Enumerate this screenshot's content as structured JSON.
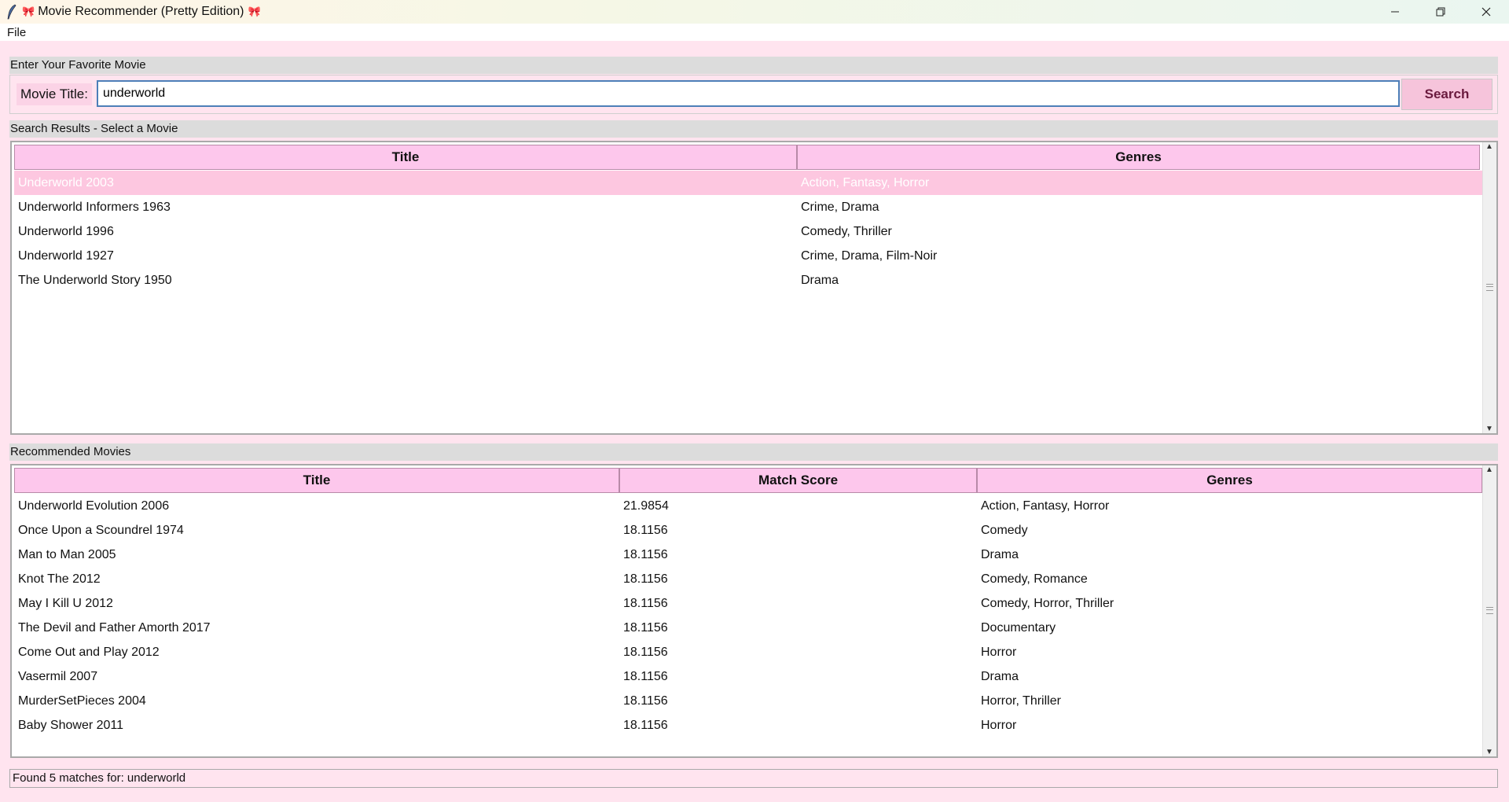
{
  "window": {
    "title": "Movie Recommender (Pretty Edition)",
    "title_emoji": "🎀",
    "controls": [
      "minimize",
      "restore",
      "close"
    ]
  },
  "menu": {
    "items": [
      "File"
    ]
  },
  "input_section": {
    "header": "Enter Your Favorite Movie",
    "label": "Movie Title:",
    "value": "underworld",
    "search_button": "Search"
  },
  "search_results": {
    "header": "Search Results - Select a Movie",
    "columns": [
      "Title",
      "Genres"
    ],
    "rows": [
      {
        "title": "Underworld 2003",
        "genres": "Action, Fantasy, Horror",
        "selected": true
      },
      {
        "title": "Underworld Informers 1963",
        "genres": "Crime, Drama"
      },
      {
        "title": "Underworld 1996",
        "genres": "Comedy, Thriller"
      },
      {
        "title": "Underworld 1927",
        "genres": "Crime, Drama, Film-Noir"
      },
      {
        "title": "The Underworld Story 1950",
        "genres": "Drama"
      }
    ]
  },
  "recommendations": {
    "header": "Recommended Movies",
    "columns": [
      "Title",
      "Match Score",
      "Genres"
    ],
    "rows": [
      {
        "title": "Underworld Evolution 2006",
        "score": "21.9854",
        "genres": "Action, Fantasy, Horror"
      },
      {
        "title": "Once Upon a Scoundrel 1974",
        "score": "18.1156",
        "genres": "Comedy"
      },
      {
        "title": "Man to Man 2005",
        "score": "18.1156",
        "genres": "Drama"
      },
      {
        "title": "Knot The 2012",
        "score": "18.1156",
        "genres": "Comedy, Romance"
      },
      {
        "title": "May I Kill U 2012",
        "score": "18.1156",
        "genres": "Comedy, Horror, Thriller"
      },
      {
        "title": "The Devil and Father Amorth 2017",
        "score": "18.1156",
        "genres": "Documentary"
      },
      {
        "title": "Come Out and Play 2012",
        "score": "18.1156",
        "genres": "Horror"
      },
      {
        "title": "Vasermil 2007",
        "score": "18.1156",
        "genres": "Drama"
      },
      {
        "title": "MurderSetPieces 2004",
        "score": "18.1156",
        "genres": "Horror, Thriller"
      },
      {
        "title": "Baby Shower 2011",
        "score": "18.1156",
        "genres": "Horror"
      }
    ]
  },
  "status": "Found 5 matches for: underworld",
  "colors": {
    "background": "#ffe4ef",
    "header_fill": "#fdc7ec",
    "selected_row": "#fdc7e0",
    "button_fill": "#f6c4db",
    "button_text": "#6a1a3e"
  }
}
